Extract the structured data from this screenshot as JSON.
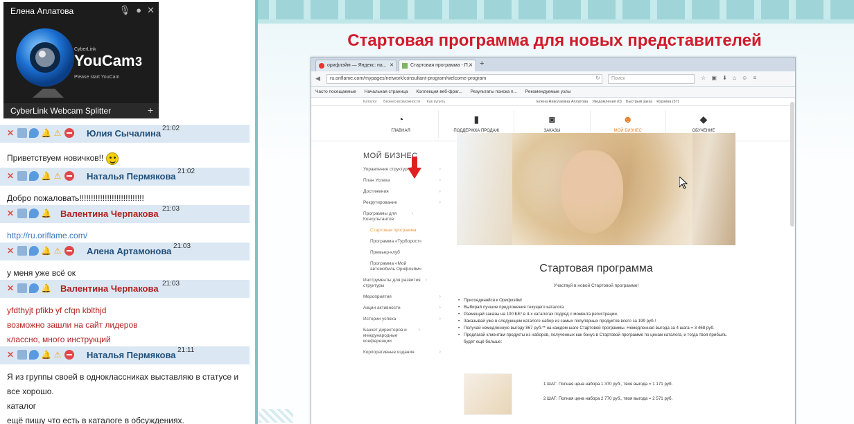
{
  "webcam": {
    "title": "Елена Аплатова",
    "brand_small": "CyberLink",
    "brand": "YouCam",
    "version": "3",
    "hint": "Please start YouCam",
    "footer": "CyberLink Webcam Splitter",
    "footer_plus": "+"
  },
  "chat": {
    "messages": [
      {
        "name": "Юлия Сычалина",
        "time": "21:02",
        "lines": [
          "Приветствуем новичков!!"
        ],
        "emoticon": true
      },
      {
        "name": "Наталья Пермякова",
        "time": "21:02",
        "lines": [
          "Добро пожаловать!!!!!!!!!!!!!!!!!!!!!!!!!!!!"
        ]
      },
      {
        "name": "Валентина Черпакова",
        "time": "21:03",
        "lines": [
          "http://ru.oriflame.com/"
        ],
        "link": true
      },
      {
        "name": "Алена Артамонова",
        "time": "21:03",
        "lines": [
          "у меня уже всё ок"
        ]
      },
      {
        "name": "Валентина Черпакова",
        "time": "21:03",
        "lines": [
          "yfdthyjt pfikb yf cfqn kblthjd",
          "возможно зашли на сайт лидеров",
          "классно, много инструкций"
        ]
      },
      {
        "name": "Наталья Пермякова",
        "time": "21:11",
        "lines": [
          "Я из группы своей в одноклассниках выставляю в статусе и",
          "все хорошо.",
          "каталог",
          "ещё пишу что есть в каталоге в обсуждениях."
        ]
      }
    ]
  },
  "slide": {
    "title": "Стартовая программа для новых представителей"
  },
  "browser": {
    "tabs": [
      {
        "label": "орифлэйм — Яндекс: на..."
      },
      {
        "label": "Стартовая программа - П..."
      }
    ],
    "new_tab": "+",
    "url": "ru.oriflame.com/mypages/network/consultant-program/welcome-program",
    "search_placeholder": "Поиск",
    "bookmarks": [
      "Часто посещаемые",
      "Начальная страница",
      "Коллекция веб-фраг...",
      "Результаты поиска п...",
      "Рекомендуемые узлы"
    ]
  },
  "site": {
    "topline_left": [
      "Каталог",
      "Бизнес-возможности",
      "Как купить"
    ],
    "topline_right": [
      "Елена Николаевна Аплатова",
      "Уведомления (0)",
      "Быстрый заказ",
      "Корзина (37)"
    ],
    "nav": [
      {
        "label": "Главная",
        "icon": "gauge-icon"
      },
      {
        "label": "Поддержка продаж",
        "icon": "lipstick-icon"
      },
      {
        "label": "Заказы",
        "icon": "shopping-bag-icon"
      },
      {
        "label": "Мой бизнес",
        "icon": "people-icon",
        "active": true
      },
      {
        "label": "Обучение",
        "icon": "book-icon"
      }
    ],
    "sidebar": {
      "heading": "МОЙ БИЗНЕС",
      "items": [
        {
          "label": "Управление структурой"
        },
        {
          "label": "План Успеха"
        },
        {
          "label": "Достижения"
        },
        {
          "label": "Рекрутирование"
        },
        {
          "label": "Программы для Консультантов"
        },
        {
          "label": "Стартовая программа",
          "sub": true,
          "active": true
        },
        {
          "label": "Программа «Турборост»",
          "sub": true
        },
        {
          "label": "Премьер-клуб",
          "sub": true
        },
        {
          "label": "Программа «Мой автомобиль Орифлэйм»",
          "sub": true
        },
        {
          "label": "Инструменты для развития структуры"
        },
        {
          "label": "Мероприятия"
        },
        {
          "label": "Акции активности"
        },
        {
          "label": "Истории успеха"
        },
        {
          "label": "Банкет директоров и международные конференции"
        },
        {
          "label": "Корпоративные издания"
        }
      ]
    },
    "main_title": "Стартовая программа",
    "main_sub": "Участвуй в новой Стартовой программе!",
    "bullets": [
      "Присоединяйся к Орифлэйм!",
      "Выбирай лучшие предложения текущего каталога",
      "Размещай заказы на 100 ББ* в 4-х каталогах подряд с момента регистрации.",
      "Заказывай уже в следующем каталоге набор из самых популярных продуктов всего за 199 руб.!",
      "Получай немедленную выгоду 867 руб.** на каждом шаге Стартовой программы. Немедленная выгода за 4 шага = 3 468 руб.",
      "Предлагай клиентам продукты из наборов, полученных как бонус в Стартовой программе по ценам каталога, и тогда твоя прибыль будет ещё больше:"
    ],
    "steps": [
      "1 ШАГ: Полная цена набора 1 370 руб., твоя выгода = 1 171 руб.",
      "2 ШАГ: Полная цена набора 2 770 руб., твоя выгода = 2 571 руб."
    ]
  }
}
